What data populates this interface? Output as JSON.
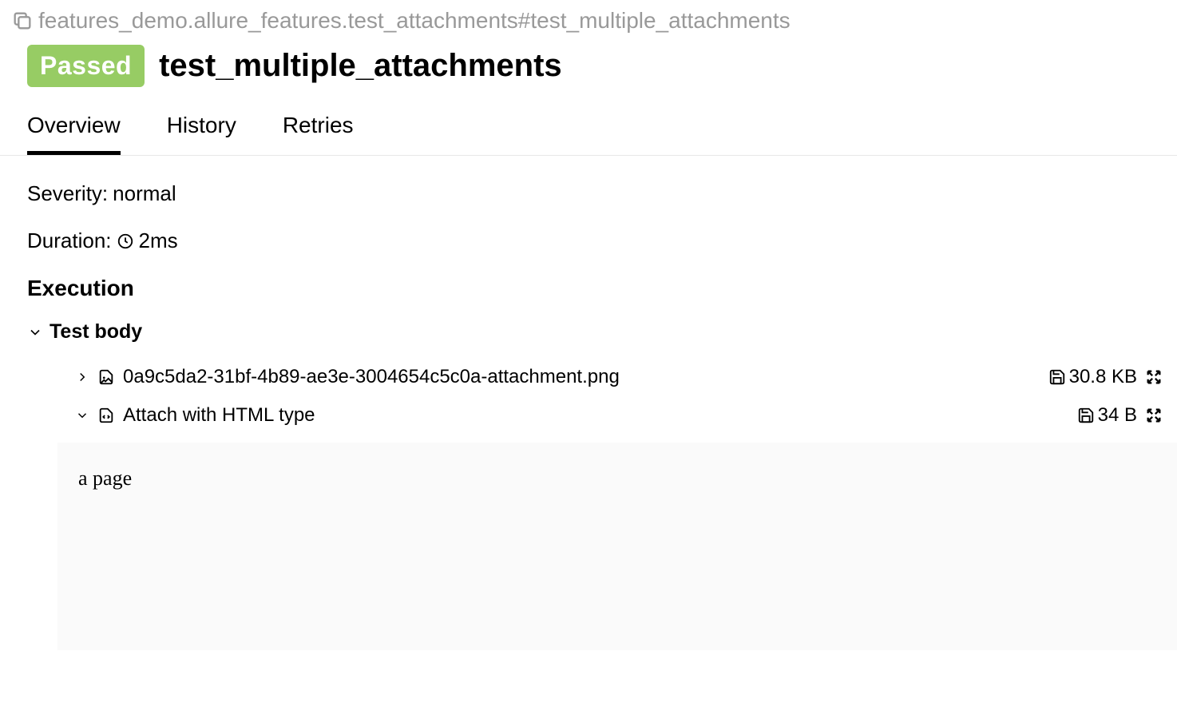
{
  "breadcrumb": "features_demo.allure_features.test_attachments#test_multiple_attachments",
  "status": "Passed",
  "title": "test_multiple_attachments",
  "tabs": [
    "Overview",
    "History",
    "Retries"
  ],
  "activeTab": 0,
  "severity": {
    "label": "Severity:",
    "value": "normal"
  },
  "duration": {
    "label": "Duration:",
    "value": "2ms"
  },
  "executionHeading": "Execution",
  "testBodyHeading": "Test body",
  "attachments": [
    {
      "name": "0a9c5da2-31bf-4b89-ae3e-3004654c5c0a-attachment.png",
      "size": "30.8 KB",
      "expanded": false,
      "type": "image"
    },
    {
      "name": "Attach with HTML type",
      "size": "34 B",
      "expanded": true,
      "type": "html",
      "content": "a page"
    }
  ]
}
